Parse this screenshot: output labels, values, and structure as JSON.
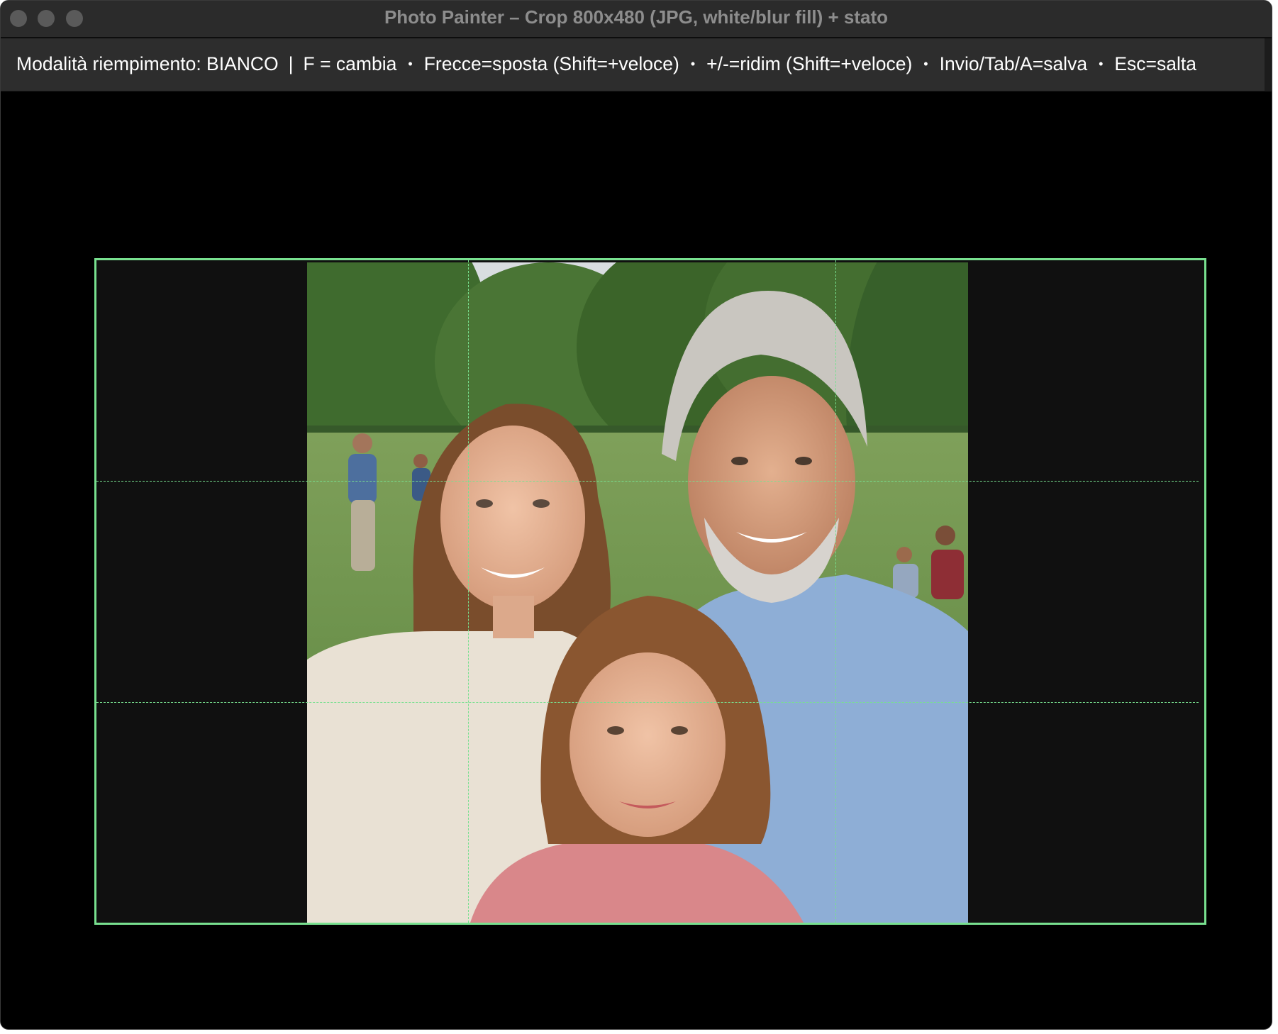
{
  "window": {
    "title": "Photo Painter – Crop 800x480 (JPG, white/blur fill) + stato"
  },
  "status": {
    "fill_mode": "Modalità riempimento: BIANCO",
    "separator": "|",
    "bullet": "•",
    "hints": [
      "F = cambia",
      "Frecce=sposta (Shift=+veloce)",
      "+/-=ridim (Shift=+veloce)",
      "Invio/Tab/A=salva",
      "Esc=salta"
    ]
  },
  "crop": {
    "frame_color": "#78e08f",
    "letterbox_color": "#101010",
    "guides": "rule-of-thirds"
  },
  "photo": {
    "subject": "family portrait in a park"
  }
}
